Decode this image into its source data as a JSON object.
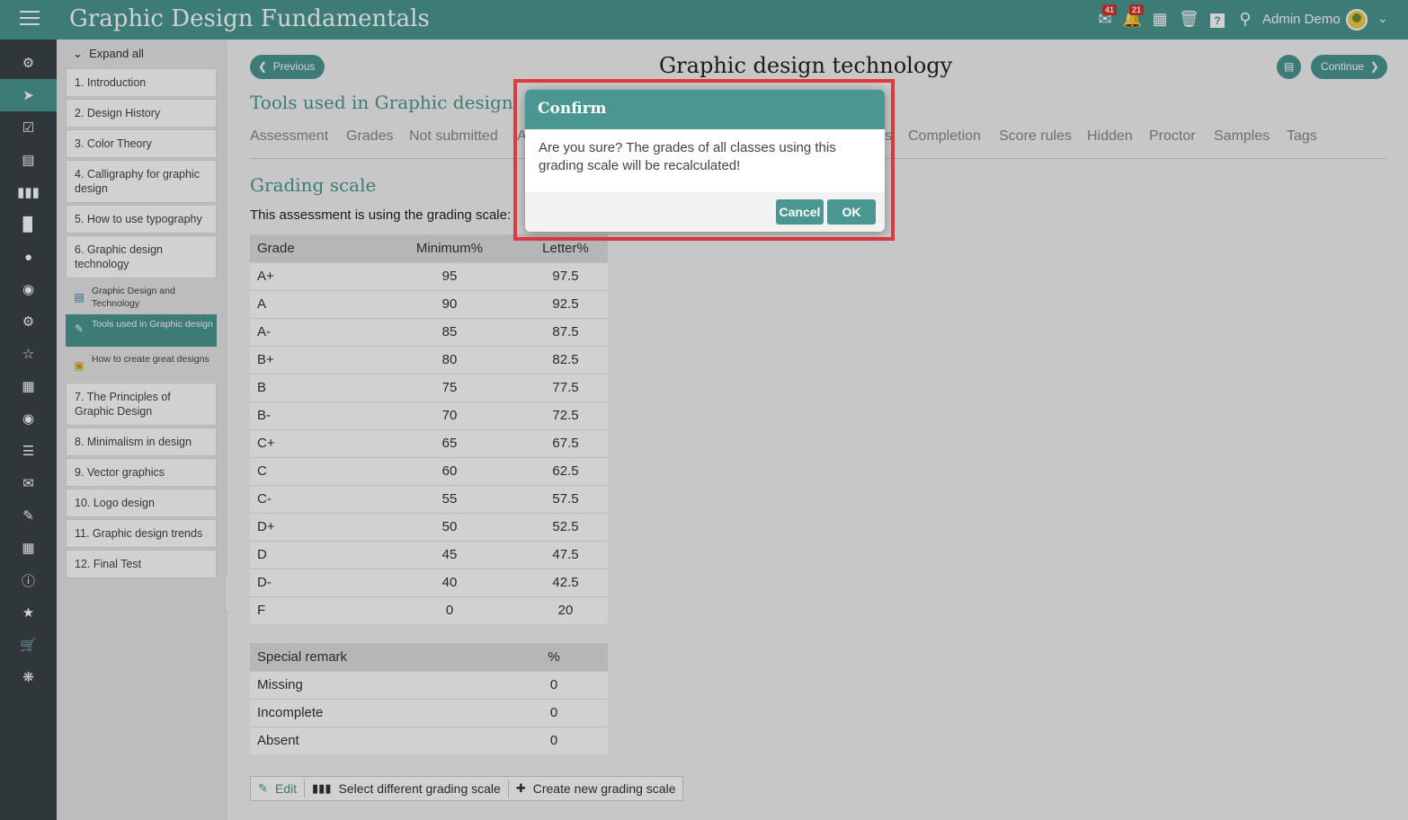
{
  "app": {
    "title": "Graphic Design Fundamentals",
    "user": "Admin Demo"
  },
  "header_badges": {
    "messages": "41",
    "notifications": "21"
  },
  "rail": [
    "gear-icon",
    "navigate-icon",
    "checklist-icon",
    "gradebook-icon",
    "library-icon",
    "chart-icon",
    "user-icon",
    "users-icon",
    "settings-icon",
    "trophy-icon",
    "grid-icon",
    "groups-icon",
    "list-icon",
    "chat-icon",
    "edit-icon",
    "calendar-icon",
    "info-icon",
    "star-icon",
    "cart-icon",
    "spinner-icon"
  ],
  "outline": {
    "expand_all": "Expand all",
    "units": [
      "1. Introduction",
      "2. Design History",
      "3. Color Theory",
      "4. Calligraphy for graphic design",
      "5. How to use typography",
      "6. Graphic design technology"
    ],
    "subitems": [
      "Graphic Design and Technology",
      "Tools used in Graphic design",
      "How to create great designs"
    ],
    "units_after": [
      "7. The Principles of Graphic Design",
      "8. Minimalism in design",
      "9. Vector graphics",
      "10. Logo design",
      "11. Graphic design trends",
      "12. Final Test"
    ]
  },
  "main": {
    "previous": "Previous",
    "continue": "Continue",
    "page_title": "Graphic design technology",
    "section_title": "Tools used in Graphic design",
    "tabs": [
      "Assessment",
      "Grades",
      "Not submitted",
      "A",
      "s",
      "Completion",
      "Score rules",
      "Hidden",
      "Proctor",
      "Samples",
      "Tags"
    ],
    "grading_title": "Grading scale",
    "grading_desc": "This assessment is using the grading scale:",
    "grades_headers": [
      "Grade",
      "Minimum%",
      "Letter%"
    ],
    "grades": [
      [
        "A+",
        "95",
        "97.5"
      ],
      [
        "A",
        "90",
        "92.5"
      ],
      [
        "A-",
        "85",
        "87.5"
      ],
      [
        "B+",
        "80",
        "82.5"
      ],
      [
        "B",
        "75",
        "77.5"
      ],
      [
        "B-",
        "70",
        "72.5"
      ],
      [
        "C+",
        "65",
        "67.5"
      ],
      [
        "C",
        "60",
        "62.5"
      ],
      [
        "C-",
        "55",
        "57.5"
      ],
      [
        "D+",
        "50",
        "52.5"
      ],
      [
        "D",
        "45",
        "47.5"
      ],
      [
        "D-",
        "40",
        "42.5"
      ],
      [
        "F",
        "0",
        "20"
      ]
    ],
    "remarks_headers": [
      "Special remark",
      "%"
    ],
    "remarks": [
      [
        "Missing",
        "0"
      ],
      [
        "Incomplete",
        "0"
      ],
      [
        "Absent",
        "0"
      ]
    ],
    "actions": [
      "Edit",
      "Select different grading scale",
      "Create new grading scale"
    ]
  },
  "modal": {
    "title": "Confirm",
    "message": "Are you sure? The grades of all classes using this grading scale will be recalculated!",
    "cancel": "Cancel",
    "ok": "OK"
  },
  "colors": {
    "accent": "#4a9690",
    "rail": "#3a4448",
    "badge": "#d9302b",
    "highlight": "#e0393e"
  }
}
